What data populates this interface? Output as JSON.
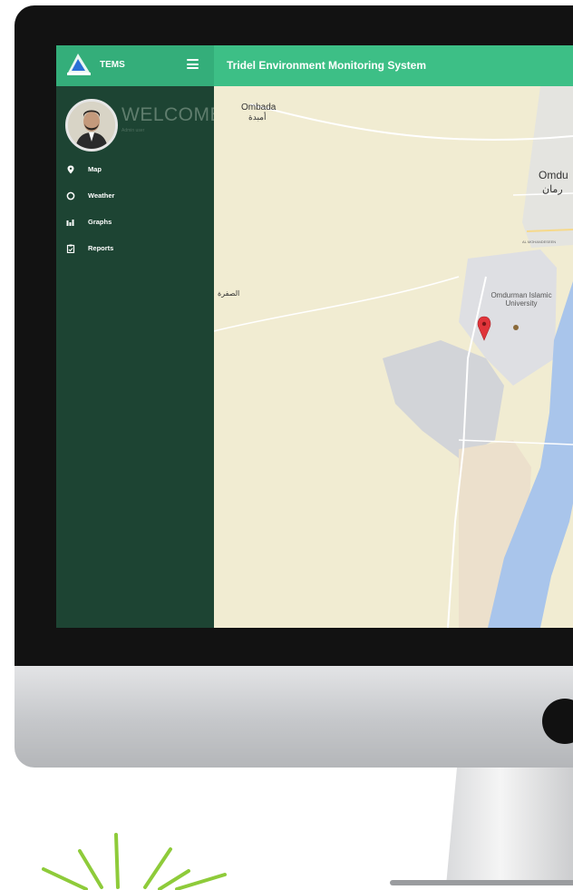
{
  "app": {
    "brand_name": "TEMS",
    "title": "Tridel Environment Monitoring System"
  },
  "sidebar": {
    "welcome": "WELCOME",
    "welcome_sub": "Admin user",
    "items": [
      {
        "label": "Map",
        "icon": "map-marker-icon"
      },
      {
        "label": "Weather",
        "icon": "circle-icon"
      },
      {
        "label": "Graphs",
        "icon": "bar-chart-icon"
      },
      {
        "label": "Reports",
        "icon": "clipboard-icon"
      }
    ]
  },
  "map": {
    "labels": {
      "ombada": "Ombada",
      "ombada_ar": "أمبدة",
      "omdurman": "Omdu",
      "omdurman_ar": "رمان",
      "safra_ar": "الصفرة",
      "university": "Omdurman Islamic University",
      "al_mohandesein": "AL MOHANDESEEN"
    }
  },
  "colors": {
    "accent": "#3dbf86",
    "sidebar": "#1d4433",
    "map_land": "#f1ecd2",
    "river": "#a9c5eb",
    "marker": "#e0343a"
  }
}
